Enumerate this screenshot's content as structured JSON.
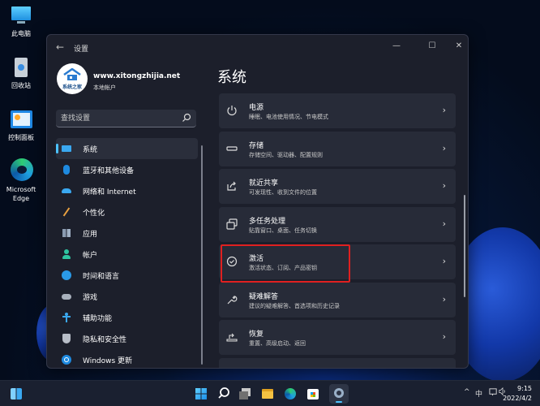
{
  "desktop": {
    "icons": [
      {
        "label": "此电脑",
        "icon": "this-pc-icon"
      },
      {
        "label": "回收站",
        "icon": "recycle-bin-icon"
      },
      {
        "label": "控制面板",
        "icon": "control-panel-icon"
      },
      {
        "label": "Microsoft Edge",
        "label_line1": "Microsoft",
        "label_line2": "Edge",
        "icon": "edge-icon"
      }
    ]
  },
  "window": {
    "title": "设置",
    "back_icon": "←",
    "controls": {
      "minimize": "—",
      "maximize": "☐",
      "close": "✕"
    }
  },
  "profile": {
    "name": "www.xitongzhijia.net",
    "account_type": "本地帐户",
    "avatar_text": "系统之家"
  },
  "search": {
    "placeholder": "查找设置",
    "value": ""
  },
  "sidebar": {
    "items": [
      {
        "label": "系统",
        "icon": "system-icon",
        "active": true
      },
      {
        "label": "蓝牙和其他设备",
        "icon": "bluetooth-icon"
      },
      {
        "label": "网络和 Internet",
        "icon": "wifi-icon"
      },
      {
        "label": "个性化",
        "icon": "brush-icon"
      },
      {
        "label": "应用",
        "icon": "apps-icon"
      },
      {
        "label": "帐户",
        "icon": "account-icon"
      },
      {
        "label": "时间和语言",
        "icon": "time-language-icon"
      },
      {
        "label": "游戏",
        "icon": "gaming-icon"
      },
      {
        "label": "辅助功能",
        "icon": "accessibility-icon"
      },
      {
        "label": "隐私和安全性",
        "icon": "shield-icon"
      },
      {
        "label": "Windows 更新",
        "icon": "windows-update-icon"
      }
    ]
  },
  "main": {
    "title": "系统",
    "cards": [
      {
        "title": "电源",
        "subtitle": "睡眠、电池使用情况、节电模式",
        "icon": "power-icon"
      },
      {
        "title": "存储",
        "subtitle": "存储空间、驱动器、配置规则",
        "icon": "storage-icon"
      },
      {
        "title": "就近共享",
        "subtitle": "可发现性、收到文件的位置",
        "icon": "nearby-share-icon"
      },
      {
        "title": "多任务处理",
        "subtitle": "贴靠窗口、桌面、任务切换",
        "icon": "multitasking-icon"
      },
      {
        "title": "激活",
        "subtitle": "激活状态、订阅、产品密钥",
        "icon": "activation-icon",
        "highlighted": true
      },
      {
        "title": "疑难解答",
        "subtitle": "建议的疑难解答、首选项和历史记录",
        "icon": "troubleshoot-icon"
      },
      {
        "title": "恢复",
        "subtitle": "重置、高级启动、返回",
        "icon": "recovery-icon"
      }
    ],
    "chevron": "›"
  },
  "taskbar": {
    "apps": [
      "widgets-icon",
      "start-icon",
      "search-icon",
      "task-view-icon",
      "file-explorer-icon",
      "edge-icon",
      "store-icon",
      "settings-icon"
    ],
    "tray": {
      "chevron": "^",
      "ime": "中"
    },
    "time": "9:15",
    "date": "2022/4/2"
  },
  "colors": {
    "accent": "#4cc2ff",
    "highlight_border": "#e02020",
    "window_bg": "#1c1f2b",
    "card_bg": "#272b38"
  }
}
